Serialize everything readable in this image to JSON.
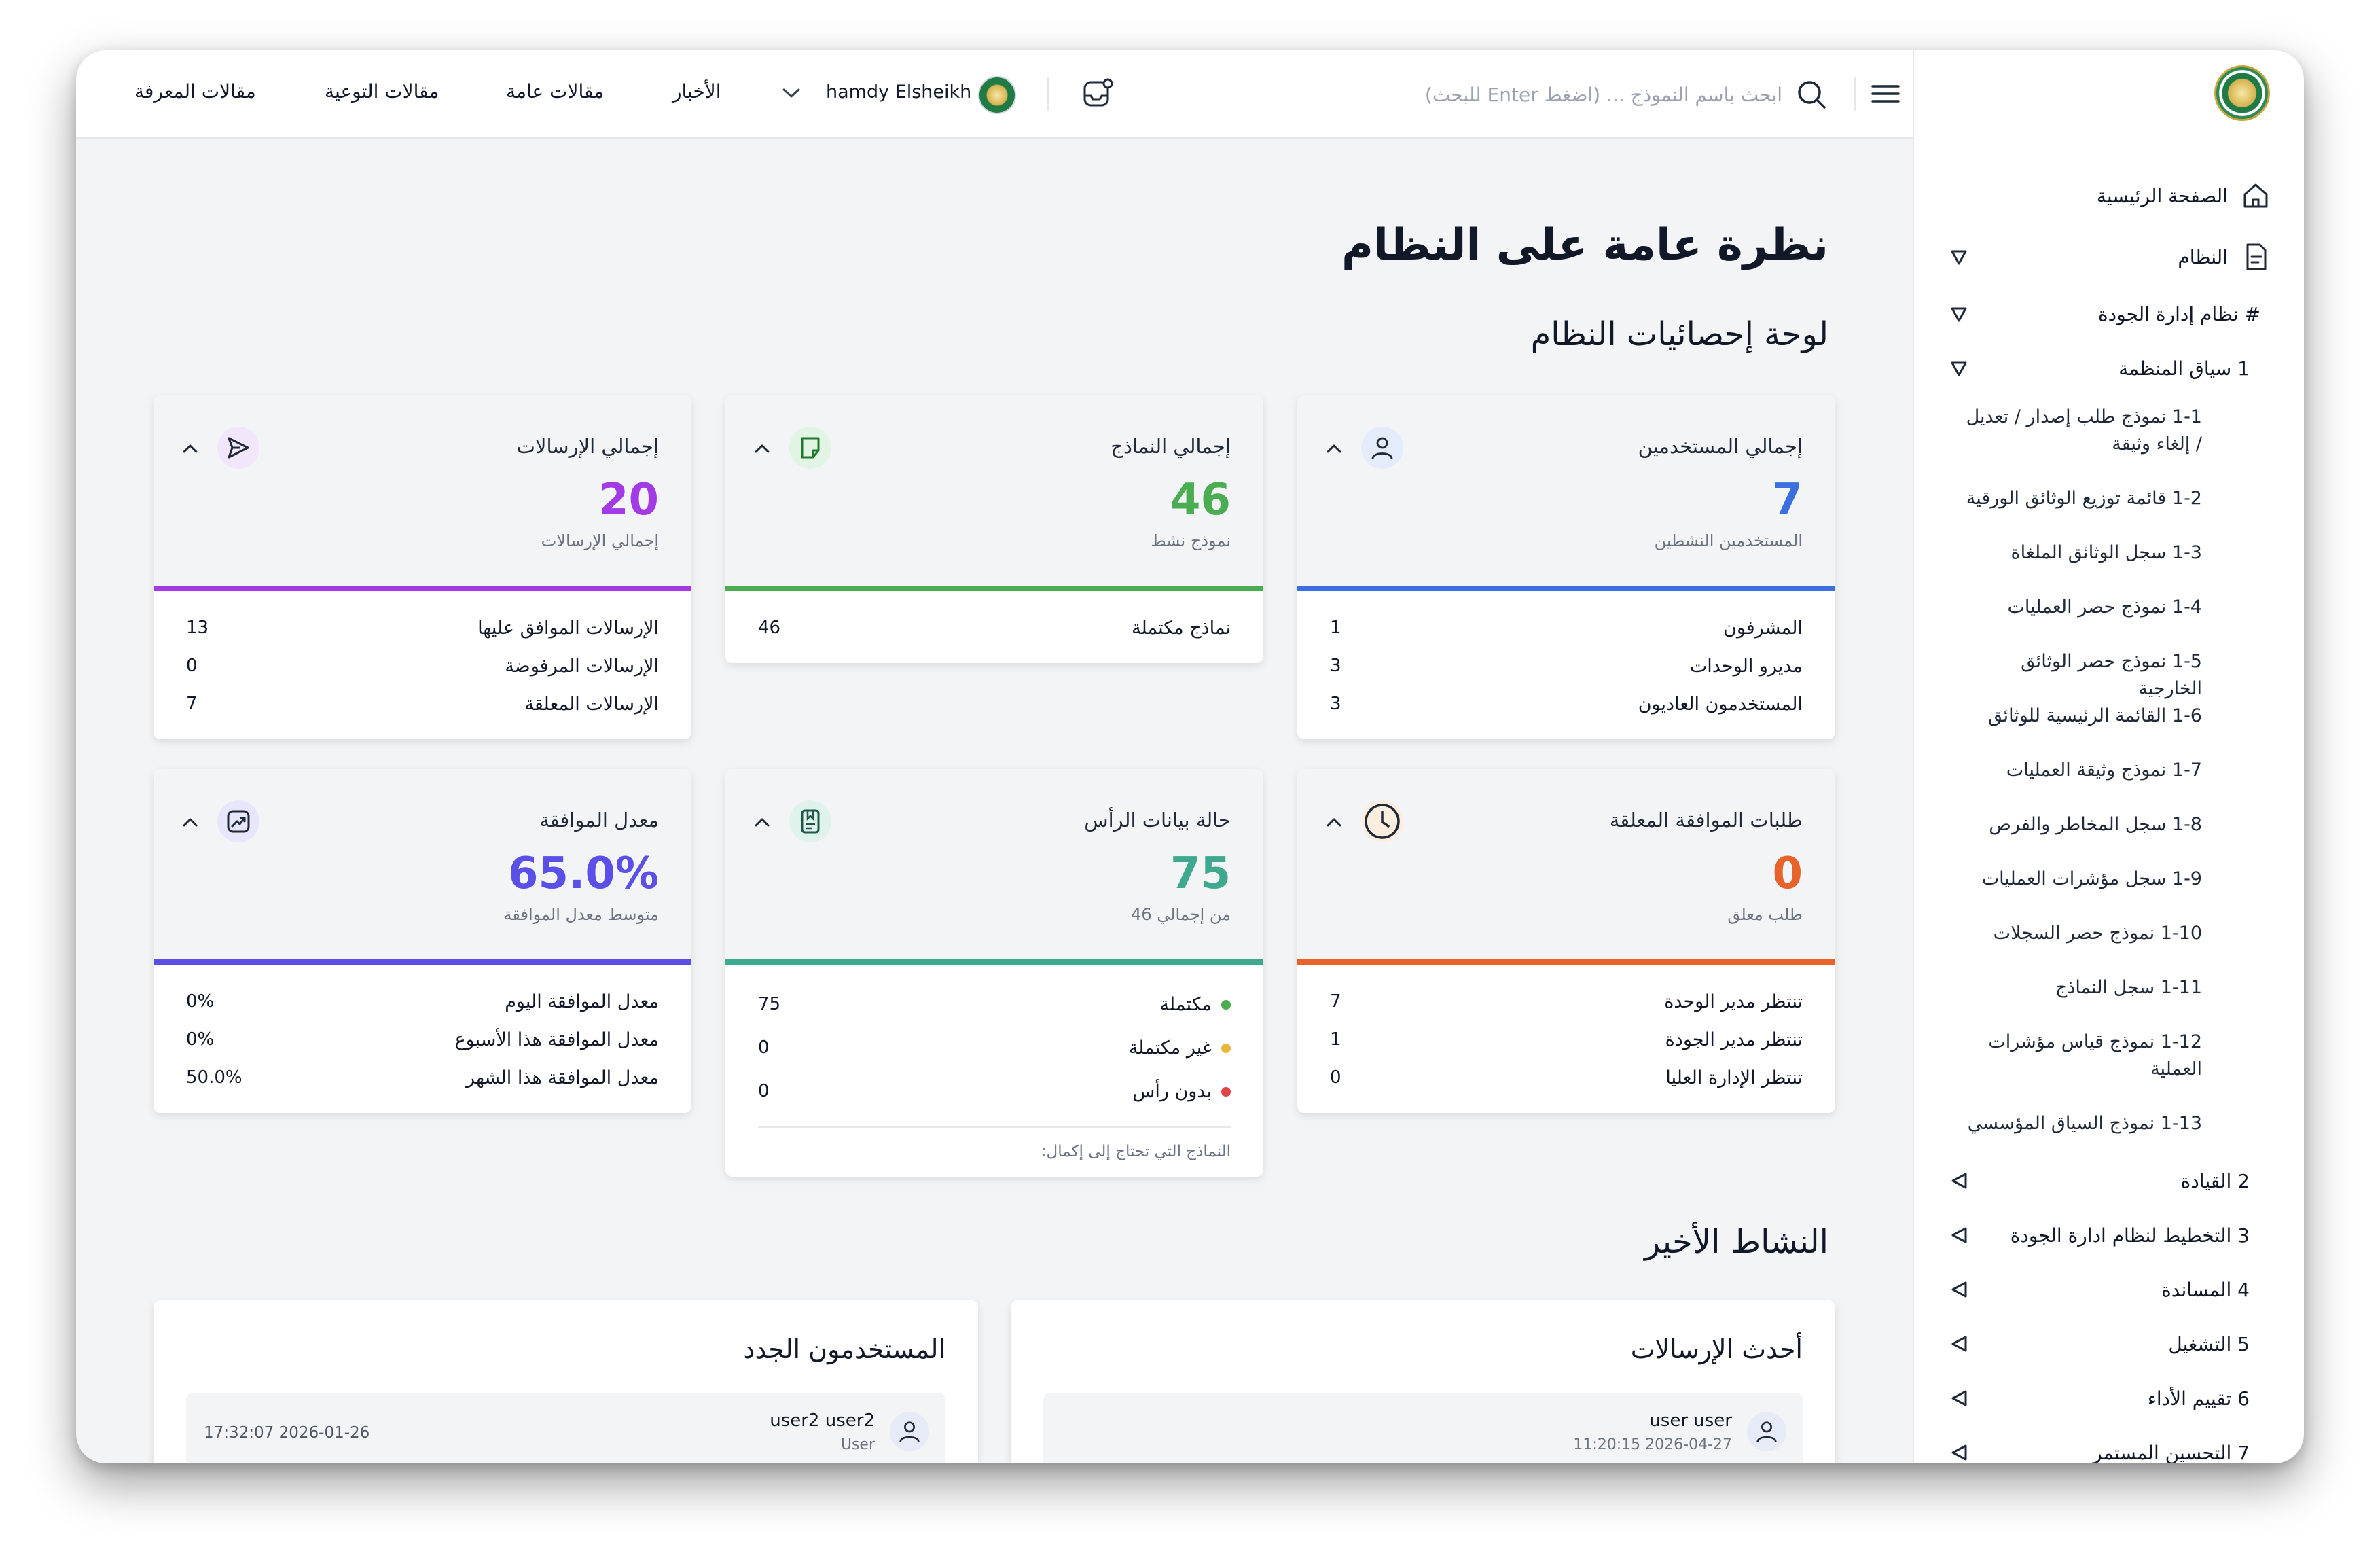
{
  "topbar": {
    "links": [
      "مقالات المعرفة",
      "مقالات التوعية",
      "مقالات عامة",
      "الأخبار"
    ],
    "user_name": "hamdy Elsheikh",
    "search_placeholder": "ابحث باسم النموذج ... (اضغط Enter للبحث)"
  },
  "sidebar": {
    "home": "الصفحة الرئيسية",
    "system": "النظام",
    "qms": "# نظام إدارة الجودة",
    "context": "1 سياق المنظمة",
    "sub_items": [
      "1-1 نموذج طلب إصدار / تعديل / إلغاء وثيقة",
      "1-2 قائمة توزيع الوثائق الورقية",
      "1-3 سجل الوثائق الملغاة",
      "1-4 نموذج حصر العمليات",
      "1-5 نموذج حصر الوثائق الخارجية",
      "1-6 القائمة الرئيسية للوثائق",
      "1-7 نموذج وثيقة العمليات",
      "1-8 سجل المخاطر والفرص",
      "1-9 سجل مؤشرات العمليات",
      "1-10 نموذج حصر السجلات",
      "1-11 سجل النماذج",
      "1-12 نموذج قياس مؤشرات العملية",
      "1-13 نموذج السياق المؤسسي"
    ],
    "sections": [
      "2 القيادة",
      "3 التخطيط لنظام ادارة الجودة",
      "4 المساندة",
      "5 التشغيل",
      "6 تقييم الأداء",
      "7 التحسين المستمر"
    ]
  },
  "main": {
    "title": "نظرة عامة على النظام",
    "stats_title": "لوحة إحصائيات النظام",
    "activity_title": "النشاط الأخير"
  },
  "cards": {
    "users": {
      "title": "إجمالي المستخدمين",
      "value": "7",
      "sub": "المستخدمين النشطين",
      "rows": [
        {
          "label": "المشرفون",
          "value": "1"
        },
        {
          "label": "مديرو الوحدات",
          "value": "3"
        },
        {
          "label": "المستخدمون العاديون",
          "value": "3"
        }
      ]
    },
    "forms": {
      "title": "إجمالي النماذج",
      "value": "46",
      "sub": "نموذج نشط",
      "rows": [
        {
          "label": "نماذج مكتملة",
          "value": "46"
        }
      ]
    },
    "submissions": {
      "title": "إجمالي الإرسالات",
      "value": "20",
      "sub": "إجمالي الإرسالات",
      "rows": [
        {
          "label": "الإرسالات الموافق عليها",
          "value": "13"
        },
        {
          "label": "الإرسالات المرفوضة",
          "value": "0"
        },
        {
          "label": "الإرسالات المعلقة",
          "value": "7"
        }
      ]
    },
    "pending": {
      "title": "طلبات الموافقة المعلقة",
      "value": "0",
      "sub": "طلب معلق",
      "rows": [
        {
          "label": "تنتظر مدير الوحدة",
          "value": "7"
        },
        {
          "label": "تنتظر مدير الجودة",
          "value": "1"
        },
        {
          "label": "تنتظر الإدارة العليا",
          "value": "0"
        }
      ]
    },
    "header_data": {
      "title": "حالة بيانات الرأس",
      "value": "75",
      "sub": "من إجمالي 46",
      "rows": [
        {
          "label": "مكتملة",
          "value": "75"
        },
        {
          "label": "غير مكتملة",
          "value": "0"
        },
        {
          "label": "بدون رأس",
          "value": "0"
        }
      ],
      "hint": "النماذج التي تحتاج إلى إكمال:"
    },
    "approval": {
      "title": "معدل الموافقة",
      "value": "65.0%",
      "sub": "متوسط معدل الموافقة",
      "rows": [
        {
          "label": "معدل الموافقة اليوم",
          "value": "0%"
        },
        {
          "label": "معدل الموافقة هذا الأسبوع",
          "value": "0%"
        },
        {
          "label": "معدل الموافقة هذا الشهر",
          "value": "50.0%"
        }
      ]
    }
  },
  "activity": {
    "latest_submissions": {
      "title": "أحدث الإرسالات",
      "items": [
        {
          "name": "user user",
          "meta": "11:20:15 2026-04-27"
        }
      ]
    },
    "new_users": {
      "title": "المستخدمون الجدد",
      "items": [
        {
          "name": "user2 user2",
          "meta": "User",
          "date": "17:32:07 2026-01-26"
        }
      ]
    }
  },
  "colors": {
    "blue": "#3b6fe0",
    "green": "#4aad52",
    "purple": "#a23be6",
    "orange": "#e8622c",
    "teal": "#3fa98f",
    "indigo": "#5a4fe6"
  }
}
